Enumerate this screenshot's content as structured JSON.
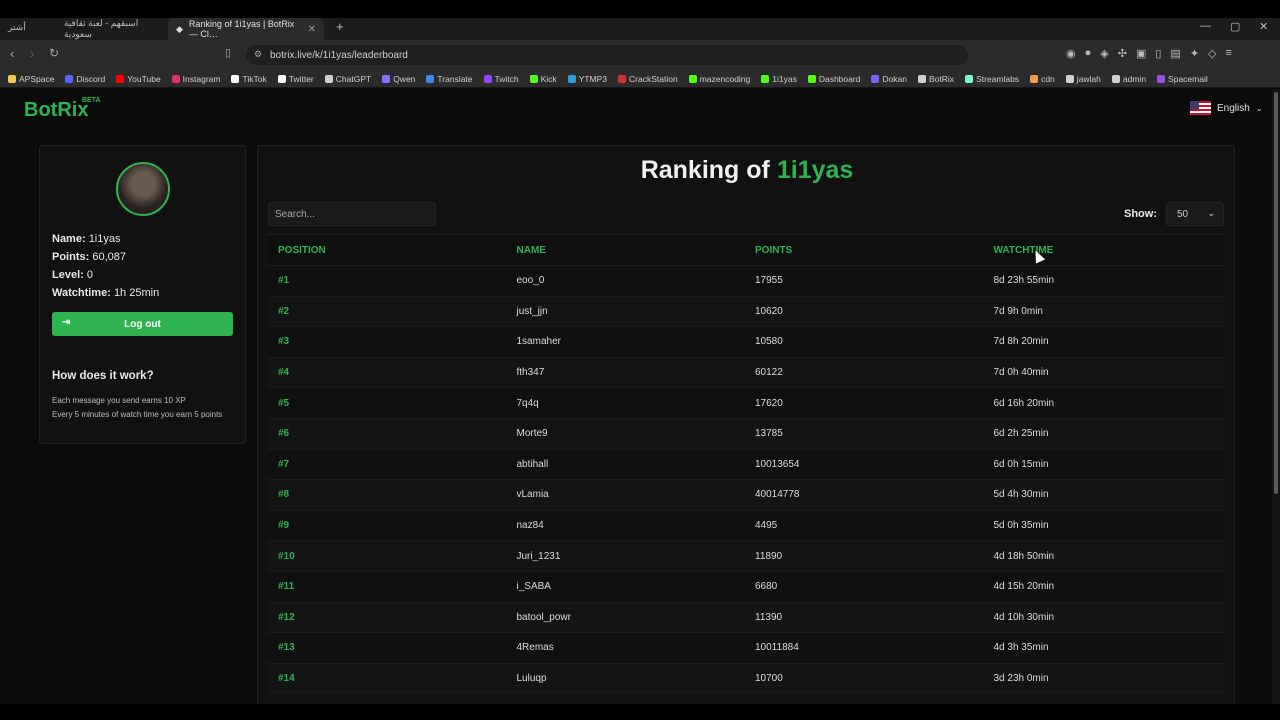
{
  "browser": {
    "app_icon_text": "أشتر",
    "tabs": [
      {
        "title": "اسبقهم - لعبة ثقافية سعودية"
      },
      {
        "title": "Ranking of 1i1yas | BotRix — Cl…"
      }
    ],
    "url": "botrix.live/k/1i1yas/leaderboard",
    "bookmarks": [
      {
        "label": "APSpace",
        "color": "#f2c94c"
      },
      {
        "label": "Discord",
        "color": "#5865f2"
      },
      {
        "label": "YouTube",
        "color": "#ff0000"
      },
      {
        "label": "Instagram",
        "color": "#e1306c"
      },
      {
        "label": "TikTok",
        "color": "#ffffff"
      },
      {
        "label": "Twitter",
        "color": "#ffffff"
      },
      {
        "label": "ChatGPT",
        "color": "#cfcfcf"
      },
      {
        "label": "Qwen",
        "color": "#8a6cff"
      },
      {
        "label": "Translate",
        "color": "#4285f4"
      },
      {
        "label": "Twitch",
        "color": "#9146ff"
      },
      {
        "label": "Kick",
        "color": "#53fc18"
      },
      {
        "label": "YTMP3",
        "color": "#2d9cdb"
      },
      {
        "label": "CrackStation",
        "color": "#d32f2f"
      },
      {
        "label": "mazencoding",
        "color": "#53fc18"
      },
      {
        "label": "1i1yas",
        "color": "#53fc18"
      },
      {
        "label": "Dashboard",
        "color": "#53fc18"
      },
      {
        "label": "Dokan",
        "color": "#7b61ff"
      },
      {
        "label": "BotRix",
        "color": "#cfcfcf"
      },
      {
        "label": "Streamlabs",
        "color": "#80f5d2"
      },
      {
        "label": "cdn",
        "color": "#f2994a"
      },
      {
        "label": "jawlah",
        "color": "#cfcfcf"
      },
      {
        "label": "admin",
        "color": "#cfcfcf"
      },
      {
        "label": "Spacemail",
        "color": "#9b51e0"
      }
    ]
  },
  "header": {
    "brand": "BotRix",
    "beta": "BETA",
    "language": "English"
  },
  "profile": {
    "name_label": "Name:",
    "name": "1i1yas",
    "points_label": "Points:",
    "points": "60,087",
    "level_label": "Level:",
    "level": "0",
    "watchtime_label": "Watchtime:",
    "watchtime": "1h 25min",
    "logout": "Log out",
    "how_title": "How does it work?",
    "how_line1": "Each message you send earns 10 XP",
    "how_line2": "Every 5 minutes of watch time you earn 5 points"
  },
  "leaderboard": {
    "title_prefix": "Ranking of",
    "title_user": "1i1yas",
    "search_placeholder": "Search...",
    "show_label": "Show:",
    "show_value": "50",
    "columns": [
      "POSITION",
      "NAME",
      "POINTS",
      "WATCHTIME"
    ],
    "rows": [
      {
        "position": "#1",
        "name": "eoo_0",
        "points": "17955",
        "watchtime": "8d 23h 55min"
      },
      {
        "position": "#2",
        "name": "just_jjn",
        "points": "10620",
        "watchtime": "7d 9h 0min"
      },
      {
        "position": "#3",
        "name": "1samaher",
        "points": "10580",
        "watchtime": "7d 8h 20min"
      },
      {
        "position": "#4",
        "name": "fth347",
        "points": "60122",
        "watchtime": "7d 0h 40min"
      },
      {
        "position": "#5",
        "name": "7q4q",
        "points": "17620",
        "watchtime": "6d 16h 20min"
      },
      {
        "position": "#6",
        "name": "Morte9",
        "points": "13785",
        "watchtime": "6d 2h 25min"
      },
      {
        "position": "#7",
        "name": "abtihall",
        "points": "10013654",
        "watchtime": "6d 0h 15min"
      },
      {
        "position": "#8",
        "name": "vLamia",
        "points": "40014778",
        "watchtime": "5d 4h 30min"
      },
      {
        "position": "#9",
        "name": "naz84",
        "points": "4495",
        "watchtime": "5d 0h 35min"
      },
      {
        "position": "#10",
        "name": "Juri_1231",
        "points": "11890",
        "watchtime": "4d 18h 50min"
      },
      {
        "position": "#11",
        "name": "i_SABA",
        "points": "6680",
        "watchtime": "4d 15h 20min"
      },
      {
        "position": "#12",
        "name": "batool_powr",
        "points": "11390",
        "watchtime": "4d 10h 30min"
      },
      {
        "position": "#13",
        "name": "4Remas",
        "points": "10011884",
        "watchtime": "4d 3h 35min"
      },
      {
        "position": "#14",
        "name": "Luluqp",
        "points": "10700",
        "watchtime": "3d 23h 0min"
      }
    ]
  }
}
